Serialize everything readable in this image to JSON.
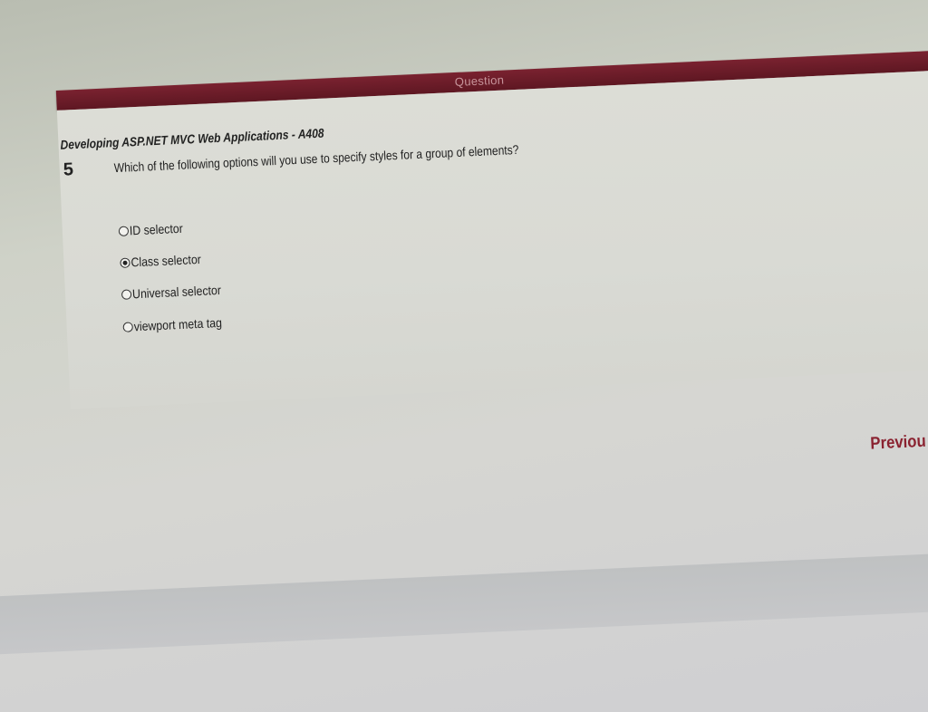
{
  "header": {
    "title": "Question"
  },
  "course": {
    "title": "Developing ASP.NET MVC Web Applications - A408"
  },
  "question": {
    "number": "5",
    "text": "Which of the following options will you use to specify styles for a group of elements?",
    "options": [
      {
        "label": "ID selector",
        "selected": false
      },
      {
        "label": "Class selector",
        "selected": true
      },
      {
        "label": "Universal selector",
        "selected": false
      },
      {
        "label": "viewport meta tag",
        "selected": false
      }
    ]
  },
  "navigation": {
    "previous_label": "Previou"
  },
  "colors": {
    "header_bar": "#6b1b27",
    "previous_link": "#8a2230",
    "panel_background": "#dcddd6"
  }
}
